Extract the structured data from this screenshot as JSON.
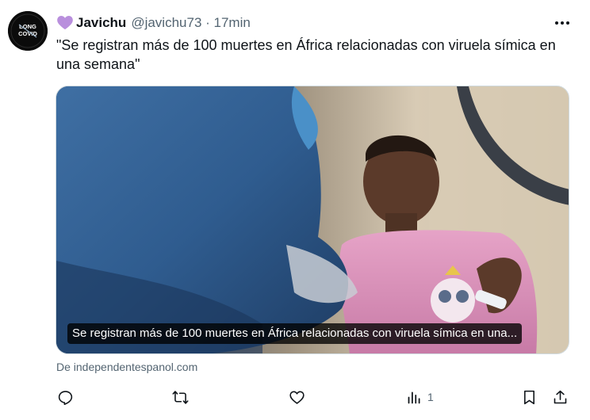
{
  "tweet": {
    "avatar_icon": "long-covid-awareness-logo",
    "avatar_text": "LONG COVID",
    "emoji": "purple-heart",
    "display_name": "Javichu",
    "handle": "@javichu73 · 17min",
    "text": "\"Se registran más de 100 muertes en África relacionadas con viruela símica en una semana\"",
    "more_icon": "more-dots-icon"
  },
  "card": {
    "caption": "Se registran más de 100 muertes en África relacionadas con viruela símica en una...",
    "source": "De independentespanol.com"
  },
  "actions": {
    "reply_icon": "reply-icon",
    "retweet_icon": "retweet-icon",
    "like_icon": "like-icon",
    "views_icon": "views-icon",
    "views_count": "1",
    "bookmark_icon": "bookmark-icon",
    "share_icon": "share-icon"
  },
  "colors": {
    "text": "#0f1419",
    "secondary": "#536471",
    "heart": "#b98fdd"
  }
}
